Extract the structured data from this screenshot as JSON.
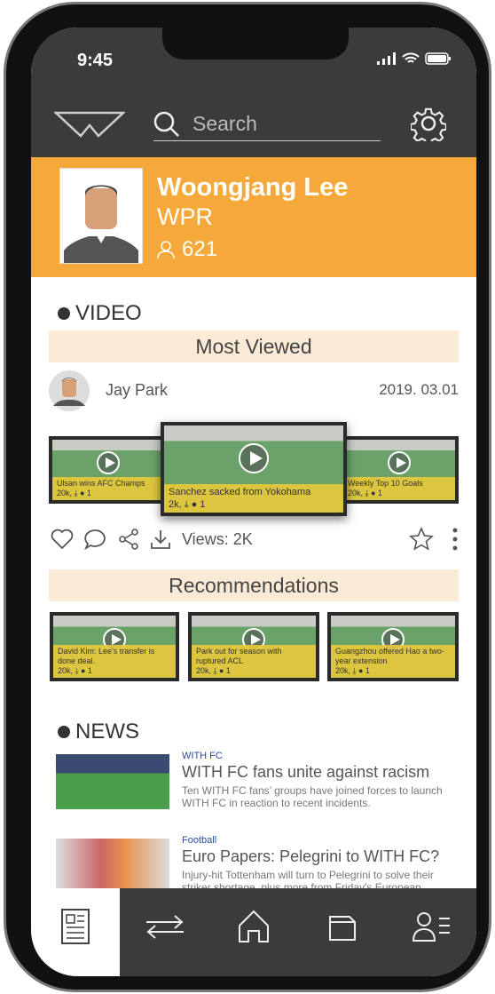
{
  "status": {
    "time": "9:45"
  },
  "header": {
    "search_placeholder": "Search"
  },
  "profile": {
    "name": "Woongjang Lee",
    "org": "WPR",
    "followers": "621"
  },
  "video": {
    "section": "VIDEO",
    "most_viewed": "Most Viewed",
    "author": "Jay Park",
    "date": "2019. 03.01",
    "carousel": [
      {
        "title": "Ulsan wins AFC Champs",
        "meta": "20k, ⤓ ● 1"
      },
      {
        "title": "Sanchez sacked from Yokohama",
        "meta": "2k, ⤓ ● 1"
      },
      {
        "title": "Weekly Top 10 Goals",
        "meta": "20k, ⤓ ● 1"
      }
    ],
    "views": "Views: 2K",
    "recommendations": "Recommendations",
    "recs": [
      {
        "title": "David Kim: Lee's transfer is done deal.",
        "meta": "20k, ⤓ ● 1"
      },
      {
        "title": "Park out for season with ruptured ACL",
        "meta": "20k, ⤓ ● 1"
      },
      {
        "title": "Guangzhou offered Hao a two-year extension",
        "meta": "20k, ⤓ ● 1"
      }
    ]
  },
  "news": {
    "section": "NEWS",
    "items": [
      {
        "category": "WITH FC",
        "title": "WITH FC fans unite against racism",
        "desc": "Ten WITH FC fans’ groups have joined forces to launch WITH FC in reaction to recent incidents."
      },
      {
        "category": "Football",
        "title": "Euro Papers: Pelegrini to WITH FC?",
        "desc": "Injury-hit Tottenham will turn to Pelegrini to solve their striker shortage, plus more from Friday's European press."
      }
    ]
  },
  "colors": {
    "accent": "#f6a93b",
    "dark": "#3b3b3b",
    "band": "#fbebd6"
  }
}
